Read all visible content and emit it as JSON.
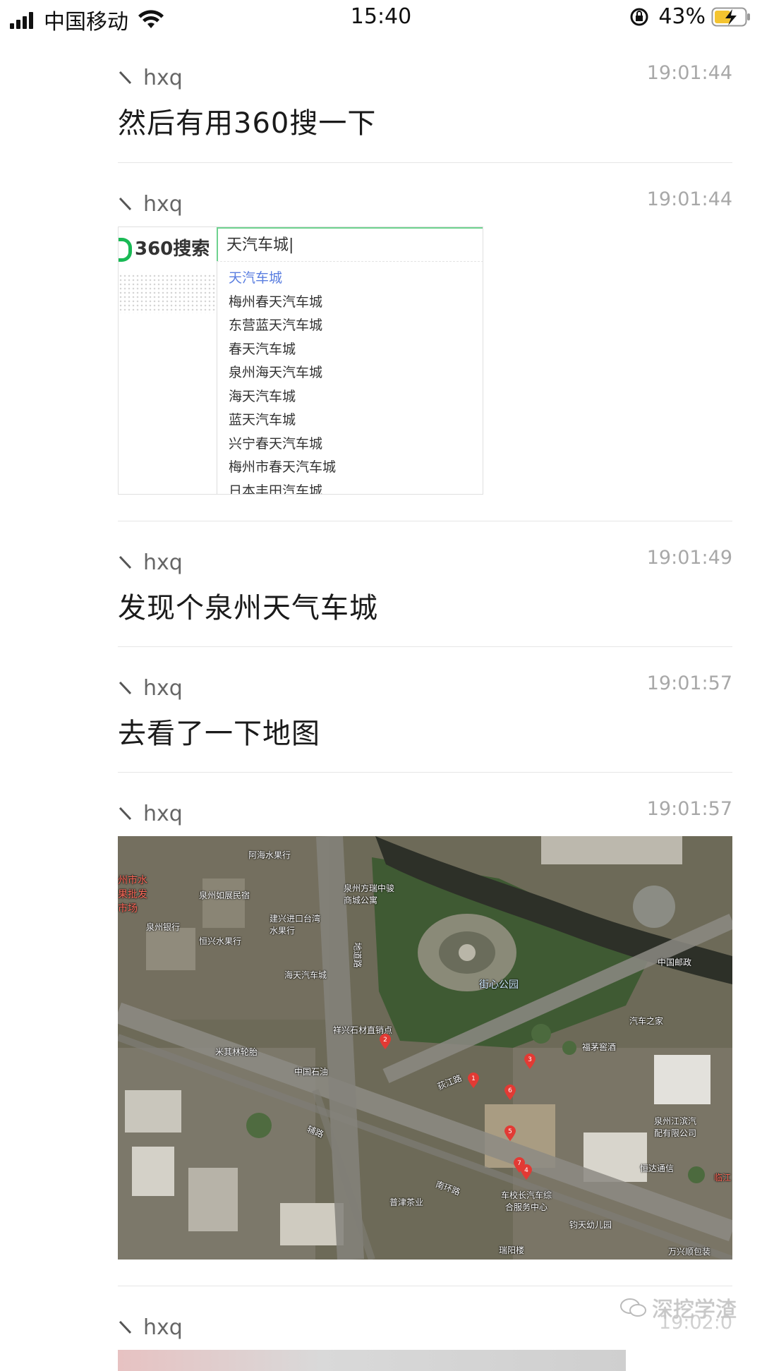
{
  "status_bar": {
    "carrier": "中国移动",
    "time": "15:40",
    "battery_percent": "43%"
  },
  "messages": [
    {
      "sender": "hxq",
      "time": "19:01:44",
      "type": "text",
      "text": "然后有用360搜一下"
    },
    {
      "sender": "hxq",
      "time": "19:01:44",
      "type": "image",
      "image": {
        "logo": "360搜索",
        "search_query": "天汽车城|",
        "suggestions": [
          "天汽车城",
          "梅州春天汽车城",
          "东营蓝天汽车城",
          "春天汽车城",
          "泉州海天汽车城",
          "海天汽车城",
          "蓝天汽车城",
          "兴宁春天汽车城",
          "梅州市春天汽车城",
          "日本丰田汽车城"
        ]
      }
    },
    {
      "sender": "hxq",
      "time": "19:01:49",
      "type": "text",
      "text": "发现个泉州天气车城"
    },
    {
      "sender": "hxq",
      "time": "19:01:57",
      "type": "text",
      "text": "去看了一下地图"
    },
    {
      "sender": "hxq",
      "time": "19:01:57",
      "type": "image",
      "map": {
        "labels": {
          "ahai_fruit": "阿海水果行",
          "fruit_market": "州市水果批发市场",
          "quanzhou_home": "泉州如展民宿",
          "quanzhou_bank": "泉州银行",
          "hengxing_fruit": "恒兴水果行",
          "jianxing_import": "建兴进口台湾水果行",
          "fangjian_apartment": "泉州方瑞中骏商城公寓",
          "park": "街心公园",
          "post": "中国邮政",
          "car_home": "汽车之家",
          "fumao_restaurant": "福茅窖酒",
          "haitian_car": "海天汽车城",
          "xiangxing_stone": "祥兴石材直销点",
          "michelin": "米其林轮胎",
          "sinopec": "中国石油",
          "jiangbin_parts": "泉州江滨汽配有限公司",
          "xianda": "恒达通信",
          "chexiaozhang": "车校长汽车综合服务中心",
          "putin_tea": "普津茶业",
          "junmei_kindergarten": "钧天幼儿园",
          "wanxing": "万兴顺包装",
          "road_nan": "南环路",
          "road_side": "辅路",
          "road_ditch": "地道路",
          "ruiyang": "瑞阳楼",
          "dijiang": "荻江路",
          "linjiang": "临江"
        },
        "pins": [
          "1",
          "2",
          "3",
          "4",
          "5",
          "6",
          "7"
        ]
      }
    },
    {
      "sender": "hxq",
      "time": "19:02:0",
      "type": "image"
    }
  ],
  "watermark": "深挖学渣"
}
